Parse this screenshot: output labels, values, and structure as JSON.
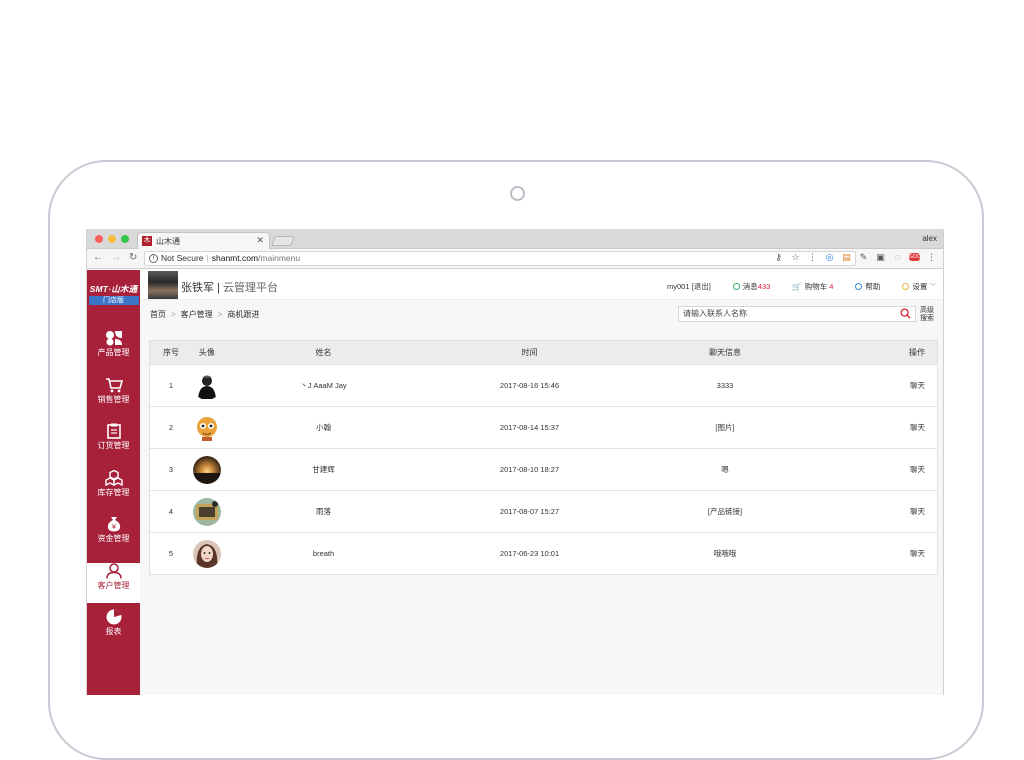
{
  "browser": {
    "tab_title": "山木通",
    "tab_favicon": "木",
    "user": "alex",
    "security_label": "Not Secure",
    "url_host": "shanmt.com",
    "url_path": "/mainmenu"
  },
  "sidebar": {
    "logo": "SMT·山木通",
    "logo_sub": "门店版",
    "items": [
      {
        "label": "产品管理",
        "icon": "product-icon"
      },
      {
        "label": "销售管理",
        "icon": "cart-icon"
      },
      {
        "label": "订货管理",
        "icon": "clipboard-icon"
      },
      {
        "label": "库存管理",
        "icon": "boxes-icon"
      },
      {
        "label": "资金管理",
        "icon": "money-bag-icon"
      },
      {
        "label": "客户管理",
        "icon": "person-icon",
        "active": true
      },
      {
        "label": "报表",
        "icon": "pie-chart-icon"
      }
    ]
  },
  "header": {
    "user_name": "张铁军",
    "separator": "|",
    "platform": "云管理平台",
    "account": "my001",
    "logout": "[退出]",
    "messages_label": "消息",
    "messages_count": "433",
    "cart_label": "购物车",
    "cart_count": "4",
    "help": "帮助",
    "settings": "设置"
  },
  "breadcrumb": [
    "首页",
    "客户管理",
    "商机跟进"
  ],
  "search": {
    "placeholder": "请输入联系人名称",
    "advanced_line1": "高级",
    "advanced_line2": "搜索"
  },
  "table": {
    "headers": {
      "no": "序号",
      "avatar": "头像",
      "name": "姓名",
      "time": "时间",
      "message": "聊天信息",
      "action": "操作"
    },
    "rows": [
      {
        "no": "1",
        "name": "丶J AaaM Jay",
        "time": "2017-08-16 15:46",
        "message": "3333",
        "action": "聊天"
      },
      {
        "no": "2",
        "name": "小翰",
        "time": "2017-08-14 15:37",
        "message": "[图片]",
        "action": "聊天"
      },
      {
        "no": "3",
        "name": "甘建辉",
        "time": "2017-08-10 18:27",
        "message": "嗯",
        "action": "聊天"
      },
      {
        "no": "4",
        "name": "雨落",
        "time": "2017-08-07 15:27",
        "message": "[产品链接]",
        "action": "聊天"
      },
      {
        "no": "5",
        "name": "breath",
        "time": "2017-06-23 10:01",
        "message": "哦哦哦",
        "action": "聊天"
      }
    ]
  },
  "colors": {
    "brand": "#a8213a",
    "accent_red": "#d9213a",
    "logo_badge": "#3c74c8"
  }
}
